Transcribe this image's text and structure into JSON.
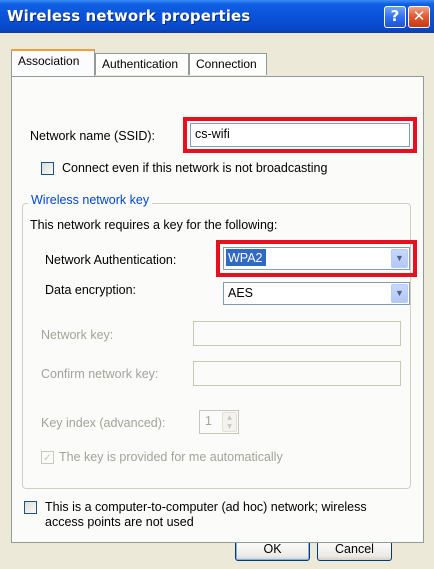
{
  "window": {
    "title": "Wireless network properties",
    "help_glyph": "?",
    "close_glyph": "✕"
  },
  "tabs": [
    {
      "label": "Association",
      "active": true
    },
    {
      "label": "Authentication",
      "active": false
    },
    {
      "label": "Connection",
      "active": false
    }
  ],
  "association": {
    "ssid_label": "Network name (SSID):",
    "ssid_value": "cs-wifi",
    "broadcast_checkbox_label": "Connect even if this network is not broadcasting",
    "broadcast_checked": false
  },
  "key_group": {
    "legend": "Wireless network key",
    "intro": "This network requires a key for the following:",
    "auth_label": "Network Authentication:",
    "auth_value": "WPA2",
    "encryption_label": "Data encryption:",
    "encryption_value": "AES",
    "network_key_label": "Network key:",
    "network_key_value": "",
    "confirm_key_label": "Confirm network key:",
    "confirm_key_value": "",
    "key_index_label": "Key index (advanced):",
    "key_index_value": "1",
    "auto_key_label": "The key is provided for me automatically",
    "auto_key_checked": true
  },
  "adhoc": {
    "label_line1": "This is a computer-to-computer (ad hoc) network; wireless",
    "label_line2": "access points are not used",
    "checked": false
  },
  "buttons": {
    "ok": "OK",
    "cancel": "Cancel"
  },
  "icons": {
    "dropdown_arrow": "chevron-down-icon",
    "checkmark": "checkmark-icon",
    "spin_up": "spin-up-icon",
    "spin_down": "spin-down-icon"
  },
  "colors": {
    "highlight": "#e8101e",
    "titlebar": "#0a52d9",
    "group_legend": "#0046d5",
    "selection": "#316ac5"
  }
}
